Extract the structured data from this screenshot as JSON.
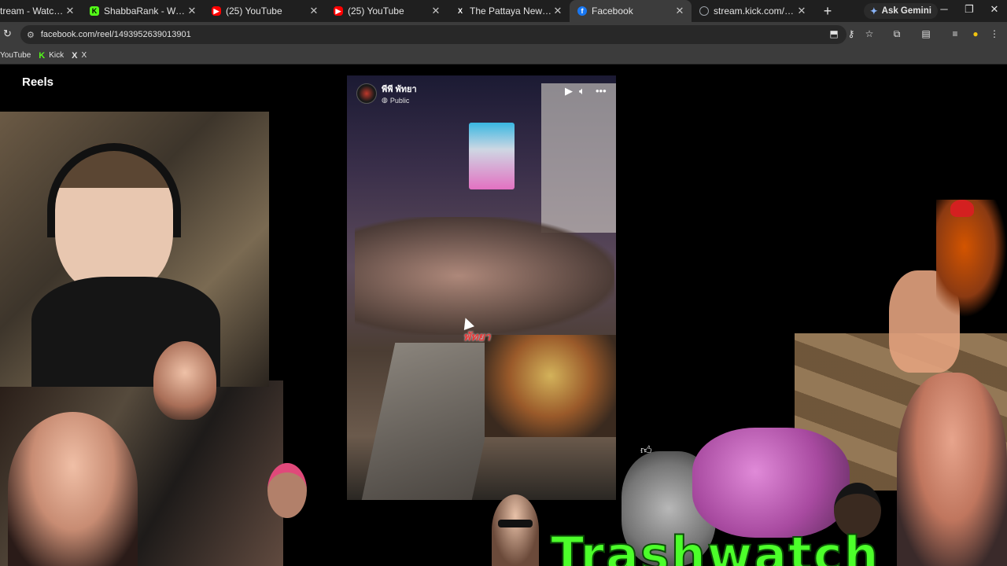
{
  "browser": {
    "tabs": [
      {
        "title": "tream - Watch Live on",
        "favicon": "kick-icon",
        "color": "#53fc18",
        "active": false
      },
      {
        "title": "ShabbaRank - Watch the VO",
        "favicon": "kick-icon",
        "color": "#53fc18",
        "active": false
      },
      {
        "title": "(25) YouTube",
        "favicon": "youtube-icon",
        "color": "#ff0000",
        "active": false
      },
      {
        "title": "(25) YouTube",
        "favicon": "youtube-icon",
        "color": "#ff0000",
        "active": false
      },
      {
        "title": "The Pattaya News Thailand",
        "favicon": "x-icon",
        "color": "#ffffff",
        "active": false
      },
      {
        "title": "Facebook",
        "favicon": "facebook-icon",
        "color": "#1877f2",
        "active": true
      },
      {
        "title": "stream.kick.com/3c81249a5",
        "favicon": "globe-icon",
        "color": "#9aa0a6",
        "active": false
      }
    ],
    "ask_gemini": "Ask Gemini",
    "url": "facebook.com/reel/1493952639013901",
    "bookmarks": [
      {
        "label": "YouTube",
        "icon": ""
      },
      {
        "label": "Kick",
        "icon": "K"
      },
      {
        "label": "X",
        "icon": "X"
      }
    ]
  },
  "page": {
    "section_title": "Reels",
    "video": {
      "page_name": "พีพี พัทยา",
      "visibility": "Public",
      "watermark": "พัทยา"
    }
  },
  "overlay": {
    "banner_text": "Trashwatch"
  }
}
